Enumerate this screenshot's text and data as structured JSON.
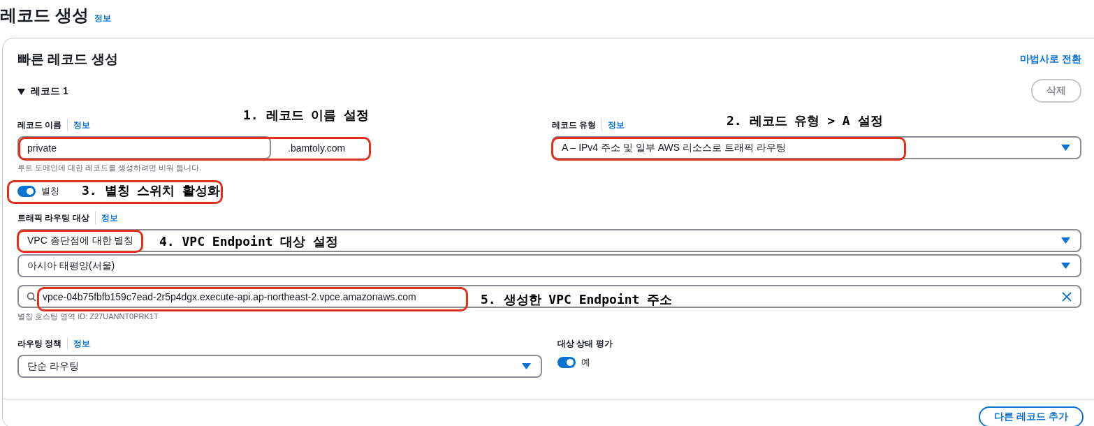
{
  "page": {
    "title": "레코드 생성",
    "info_link": "정보"
  },
  "card": {
    "title": "빠른 레코드 생성",
    "wizard_link": "마법사로 전환"
  },
  "record": {
    "title": "레코드 1",
    "expanded": true,
    "delete_button": {
      "label": "삭제",
      "disabled": true
    },
    "record_name": {
      "label": "레코드 이름",
      "info": "정보",
      "value": "private",
      "suffix": ".bamtoly.com",
      "hint": "루트 도메인에 대한 레코드를 생성하려면 비워 둡니다."
    },
    "record_type": {
      "label": "레코드 유형",
      "info": "정보",
      "value": "A – IPv4 주소 및 일부 AWS 리소스로 트래픽 라우팅"
    },
    "alias": {
      "label": "별칭",
      "on": true
    },
    "routing_target": {
      "label": "트래픽 라우팅 대상",
      "info": "정보",
      "endpoint_type": "VPC 종단점에 대한 별칭",
      "region": "아시아 태평양(서울)",
      "endpoint": "vpce-04b75fbfb159c7ead-2r5p4dgx.execute-api.ap-northeast-2.vpce.amazonaws.com",
      "hint": "별칭 호스팅 영역 ID: Z27UANNT0PRK1T"
    },
    "routing_policy": {
      "label": "라우팅 정책",
      "info": "정보",
      "value": "단순 라우팅"
    },
    "health_check": {
      "label": "대상 상태 평가",
      "toggle_label": "예",
      "on": true
    }
  },
  "add_button": "다른 레코드 추가",
  "annotations": [
    {
      "text": "1. 레코드 이름 설정"
    },
    {
      "text": "2. 레코드 유형 > A 설정"
    },
    {
      "text": "3. 별칭 스위치 활성화"
    },
    {
      "text": "4. VPC Endpoint 대상 설정"
    },
    {
      "text": "5. 생성한 VPC Endpoint 주소"
    }
  ]
}
